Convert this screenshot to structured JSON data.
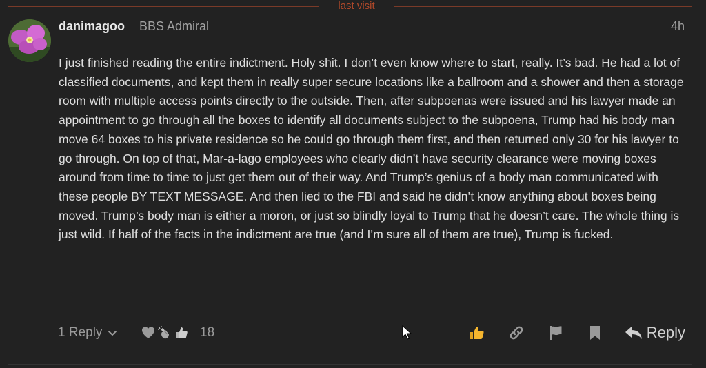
{
  "divider": {
    "label": "last visit",
    "color": "#b0492a"
  },
  "post": {
    "author": {
      "username": "danimagoo",
      "title": "BBS Admiral",
      "avatar": "pink-flower-avatar"
    },
    "timestamp": "4h",
    "body": "I just finished reading the entire indictment. Holy shit. I don’t even know where to start, really. It’s bad. He had a lot of classified documents, and kept them in really super secure locations like a ballroom and a shower and then a storage room with multiple access points directly to the outside. Then, after subpoenas were issued and his lawyer made an appointment to go through all the boxes to identify all documents subject to the subpoena, Trump had his body man move 64 boxes to his private residence so he could go through them first, and then returned only 30 for his lawyer to go through. On top of that, Mar-a-lago employees who clearly didn’t have security clearance were moving boxes around from time to time to just get them out of their way. And Trump’s genius of a body man communicated with these people BY TEXT MESSAGE. And then lied to the FBI and said he didn’t know anything about boxes being moved. Trump’s body man is either a moron, or just so blindly loyal to Trump that he doesn’t care. The whole thing is just wild. If half of the facts in the indictment are true (and I’m sure all of them are true), Trump is fucked."
  },
  "footer": {
    "replies_label": "1 Reply",
    "reactions": {
      "icons": [
        "heart-icon",
        "clapping-hands-icon",
        "thumbs-up-icon"
      ],
      "count": "18"
    },
    "actions": [
      "like-icon",
      "link-icon",
      "flag-icon",
      "bookmark-icon"
    ],
    "reply_label": "Reply"
  },
  "colors": {
    "background": "#222222",
    "text": "#dedede",
    "muted": "#9a9a9a",
    "accent": "#b0492a",
    "like": "#f5b52e"
  }
}
